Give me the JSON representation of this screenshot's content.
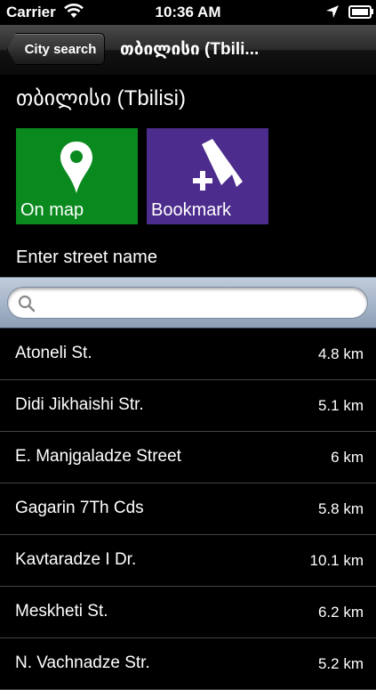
{
  "status": {
    "carrier": "Carrier",
    "time": "10:36 AM"
  },
  "nav": {
    "back_label": "City search",
    "title": "თბილისი (Tbili..."
  },
  "city": {
    "title": "თბილისი (Tbilisi)"
  },
  "tiles": {
    "map_label": "On map",
    "map_color": "#0a8a1e",
    "bookmark_label": "Bookmark",
    "bookmark_color": "#4c2c8c"
  },
  "street_prompt": "Enter street name",
  "search": {
    "value": "",
    "placeholder": ""
  },
  "streets": [
    {
      "name": "Atoneli St.",
      "distance": "4.8 km"
    },
    {
      "name": "Didi Jikhaishi Str.",
      "distance": "5.1 km"
    },
    {
      "name": "E. Manjgaladze Street",
      "distance": "6 km"
    },
    {
      "name": "Gagarin 7Th Cds",
      "distance": "5.8 km"
    },
    {
      "name": "Kavtaradze I Dr.",
      "distance": "10.1 km"
    },
    {
      "name": "Meskheti St.",
      "distance": "6.2 km"
    },
    {
      "name": "N. Vachnadze Str.",
      "distance": "5.2 km"
    }
  ]
}
